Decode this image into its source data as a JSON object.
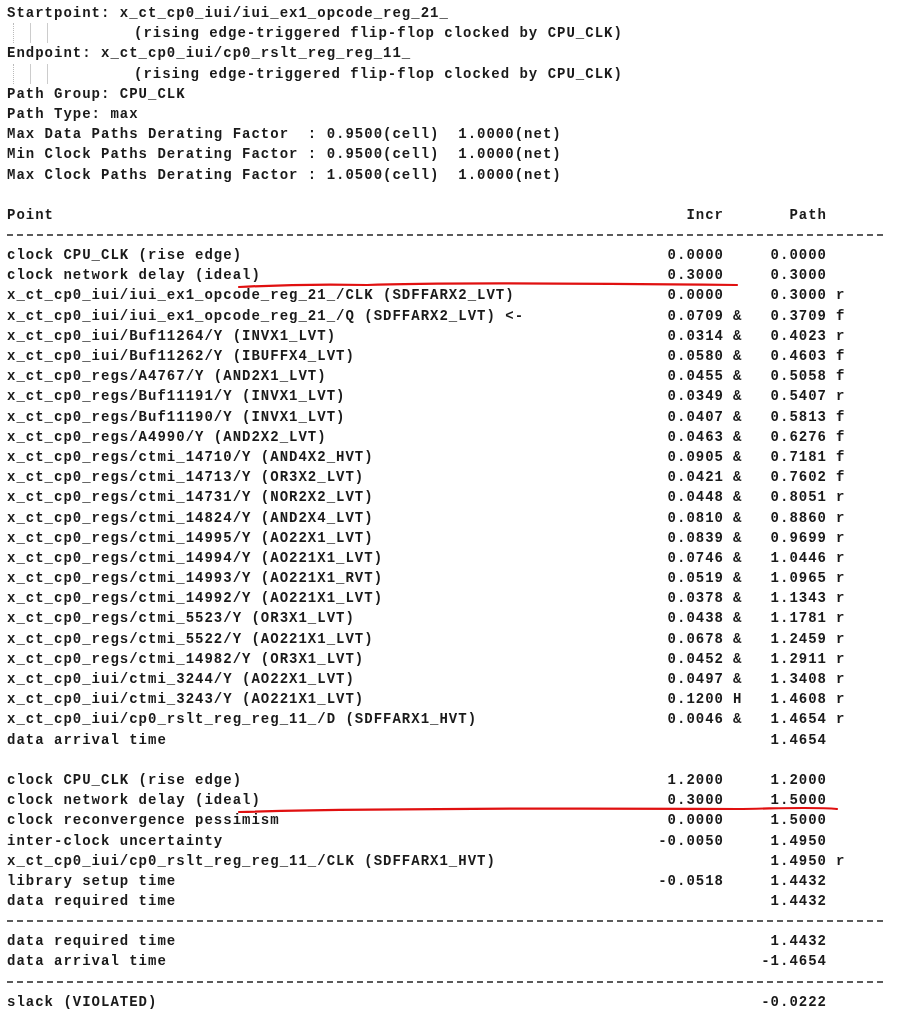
{
  "header_lines": [
    {
      "kind": "line",
      "text": "Startpoint: x_ct_cp0_iui/iui_ex1_opcode_reg_21_"
    },
    {
      "kind": "continuation",
      "text": "(rising edge-triggered flip-flop clocked by CPU_CLK)"
    },
    {
      "kind": "line",
      "text": "Endpoint: x_ct_cp0_iui/cp0_rslt_reg_reg_11_"
    },
    {
      "kind": "continuation",
      "text": "(rising edge-triggered flip-flop clocked by CPU_CLK)"
    },
    {
      "kind": "line",
      "text": "Path Group: CPU_CLK"
    },
    {
      "kind": "line",
      "text": "Path Type: max"
    },
    {
      "kind": "line",
      "text": "Max Data Paths Derating Factor  : 0.9500(cell)  1.0000(net)"
    },
    {
      "kind": "line",
      "text": "Min Clock Paths Derating Factor : 0.9500(cell)  1.0000(net)"
    },
    {
      "kind": "line",
      "text": "Max Clock Paths Derating Factor : 1.0500(cell)  1.0000(net)"
    }
  ],
  "columns": [
    "Point",
    "Incr",
    "Path"
  ],
  "sections": [
    {
      "blocks": [
        [
          {
            "point": "clock CPU_CLK (rise edge)",
            "incr": "0.0000",
            "path": "0.0000",
            "underlined": false
          },
          {
            "point": "clock network delay (ideal)",
            "incr": "0.3000",
            "path": "0.3000",
            "underlined": true
          },
          {
            "point": "x_ct_cp0_iui/iui_ex1_opcode_reg_21_/CLK (SDFFARX2_LVT)",
            "incr": "0.0000",
            "path": "0.3000",
            "path_flag": "r",
            "underlined": false
          },
          {
            "point": "x_ct_cp0_iui/iui_ex1_opcode_reg_21_/Q (SDFFARX2_LVT) <-",
            "incr": "0.0709",
            "incr_flag": "&",
            "path": "0.3709",
            "path_flag": "f",
            "underlined": false
          },
          {
            "point": "x_ct_cp0_iui/Buf11264/Y (INVX1_LVT)",
            "incr": "0.0314",
            "incr_flag": "&",
            "path": "0.4023",
            "path_flag": "r",
            "underlined": false
          },
          {
            "point": "x_ct_cp0_iui/Buf11262/Y (IBUFFX4_LVT)",
            "incr": "0.0580",
            "incr_flag": "&",
            "path": "0.4603",
            "path_flag": "f",
            "underlined": false
          },
          {
            "point": "x_ct_cp0_regs/A4767/Y (AND2X1_LVT)",
            "incr": "0.0455",
            "incr_flag": "&",
            "path": "0.5058",
            "path_flag": "f",
            "underlined": false
          },
          {
            "point": "x_ct_cp0_regs/Buf11191/Y (INVX1_LVT)",
            "incr": "0.0349",
            "incr_flag": "&",
            "path": "0.5407",
            "path_flag": "r",
            "underlined": false
          },
          {
            "point": "x_ct_cp0_regs/Buf11190/Y (INVX1_LVT)",
            "incr": "0.0407",
            "incr_flag": "&",
            "path": "0.5813",
            "path_flag": "f",
            "underlined": false
          },
          {
            "point": "x_ct_cp0_regs/A4990/Y (AND2X2_LVT)",
            "incr": "0.0463",
            "incr_flag": "&",
            "path": "0.6276",
            "path_flag": "f",
            "underlined": false
          },
          {
            "point": "x_ct_cp0_regs/ctmi_14710/Y (AND4X2_HVT)",
            "incr": "0.0905",
            "incr_flag": "&",
            "path": "0.7181",
            "path_flag": "f",
            "underlined": false
          },
          {
            "point": "x_ct_cp0_regs/ctmi_14713/Y (OR3X2_LVT)",
            "incr": "0.0421",
            "incr_flag": "&",
            "path": "0.7602",
            "path_flag": "f",
            "underlined": false
          },
          {
            "point": "x_ct_cp0_regs/ctmi_14731/Y (NOR2X2_LVT)",
            "incr": "0.0448",
            "incr_flag": "&",
            "path": "0.8051",
            "path_flag": "r",
            "underlined": false
          },
          {
            "point": "x_ct_cp0_regs/ctmi_14824/Y (AND2X4_LVT)",
            "incr": "0.0810",
            "incr_flag": "&",
            "path": "0.8860",
            "path_flag": "r",
            "underlined": false
          },
          {
            "point": "x_ct_cp0_regs/ctmi_14995/Y (AO22X1_LVT)",
            "incr": "0.0839",
            "incr_flag": "&",
            "path": "0.9699",
            "path_flag": "r",
            "underlined": false
          },
          {
            "point": "x_ct_cp0_regs/ctmi_14994/Y (AO221X1_LVT)",
            "incr": "0.0746",
            "incr_flag": "&",
            "path": "1.0446",
            "path_flag": "r",
            "underlined": false
          },
          {
            "point": "x_ct_cp0_regs/ctmi_14993/Y (AO221X1_RVT)",
            "incr": "0.0519",
            "incr_flag": "&",
            "path": "1.0965",
            "path_flag": "r",
            "underlined": false
          },
          {
            "point": "x_ct_cp0_regs/ctmi_14992/Y (AO221X1_LVT)",
            "incr": "0.0378",
            "incr_flag": "&",
            "path": "1.1343",
            "path_flag": "r",
            "underlined": false
          },
          {
            "point": "x_ct_cp0_regs/ctmi_5523/Y (OR3X1_LVT)",
            "incr": "0.0438",
            "incr_flag": "&",
            "path": "1.1781",
            "path_flag": "r",
            "underlined": false
          },
          {
            "point": "x_ct_cp0_regs/ctmi_5522/Y (AO221X1_LVT)",
            "incr": "0.0678",
            "incr_flag": "&",
            "path": "1.2459",
            "path_flag": "r",
            "underlined": false
          },
          {
            "point": "x_ct_cp0_regs/ctmi_14982/Y (OR3X1_LVT)",
            "incr": "0.0452",
            "incr_flag": "&",
            "path": "1.2911",
            "path_flag": "r",
            "underlined": false
          },
          {
            "point": "x_ct_cp0_iui/ctmi_3244/Y (AO22X1_LVT)",
            "incr": "0.0497",
            "incr_flag": "&",
            "path": "1.3408",
            "path_flag": "r",
            "underlined": false
          },
          {
            "point": "x_ct_cp0_iui/ctmi_3243/Y (AO221X1_LVT)",
            "incr": "0.1200",
            "incr_flag": "H",
            "path": "1.4608",
            "path_flag": "r",
            "underlined": false
          },
          {
            "point": "x_ct_cp0_iui/cp0_rslt_reg_reg_11_/D (SDFFARX1_HVT)",
            "incr": "0.0046",
            "incr_flag": "&",
            "path": "1.4654",
            "path_flag": "r",
            "underlined": false
          },
          {
            "point": "data arrival time",
            "path": "1.4654",
            "underlined": false
          }
        ],
        [
          {
            "point": "clock CPU_CLK (rise edge)",
            "incr": "1.2000",
            "path": "1.2000",
            "underlined": false
          },
          {
            "point": "clock network delay (ideal)",
            "incr": "0.3000",
            "path": "1.5000",
            "underlined": true
          },
          {
            "point": "clock reconvergence pessimism",
            "incr": "0.0000",
            "path": "1.5000",
            "underlined": false
          },
          {
            "point": "inter-clock uncertainty",
            "incr": "-0.0050",
            "path": "1.4950",
            "underlined": false
          },
          {
            "point": "x_ct_cp0_iui/cp0_rslt_reg_reg_11_/CLK (SDFFARX1_HVT)",
            "path": "1.4950",
            "path_flag": "r",
            "underlined": false
          },
          {
            "point": "library setup time",
            "incr": "-0.0518",
            "path": "1.4432",
            "underlined": false
          },
          {
            "point": "data required time",
            "path": "1.4432",
            "underlined": false
          }
        ]
      ]
    },
    {
      "blocks": [
        [
          {
            "point": "data required time",
            "path": "1.4432",
            "underlined": false
          },
          {
            "point": "data arrival time",
            "path": "-1.4654",
            "underlined": false
          }
        ]
      ]
    },
    {
      "blocks": [
        [
          {
            "point": "slack (VIOLATED)",
            "path": "-0.0222",
            "underlined": false
          }
        ]
      ]
    }
  ]
}
